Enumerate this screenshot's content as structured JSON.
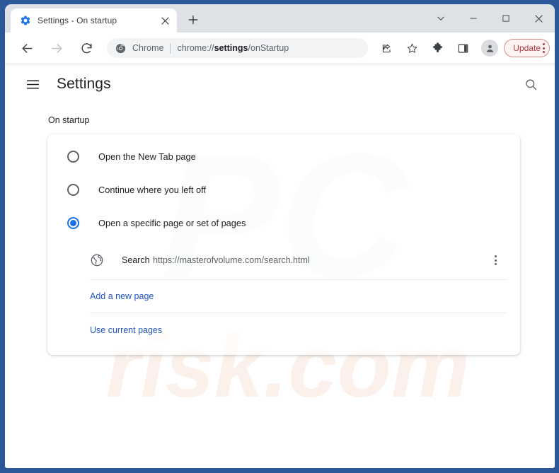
{
  "window": {
    "frame_color": "#2c5899",
    "controls": [
      {
        "name": "tab-search",
        "icon": "chevron-down-icon"
      },
      {
        "name": "minimize",
        "icon": "minimize-icon"
      },
      {
        "name": "maximize",
        "icon": "maximize-icon"
      },
      {
        "name": "close",
        "icon": "close-icon"
      }
    ]
  },
  "tabstrip": {
    "tabs": [
      {
        "title": "Settings - On startup",
        "favicon": "gear-icon",
        "active": true
      }
    ],
    "new_tab_label": "+"
  },
  "toolbar": {
    "back_icon": "back-arrow-icon",
    "forward_icon": "forward-arrow-icon",
    "reload_icon": "reload-icon",
    "omnibox": {
      "chrome_label": "Chrome",
      "url_prefix": "chrome://",
      "url_bold": "settings",
      "url_suffix": "/onStartup",
      "full_url": "chrome://settings/onStartup",
      "icon": "chrome-logo-icon"
    },
    "actions": [
      {
        "name": "share-icon"
      },
      {
        "name": "bookmark-star-icon"
      },
      {
        "name": "extensions-puzzle-icon"
      },
      {
        "name": "side-panel-icon"
      },
      {
        "name": "profile-avatar-icon"
      }
    ],
    "update_button": {
      "label": "Update",
      "text_color": "#b3383d",
      "border_color": "#d08e8e",
      "background_color": "#fdf3f3"
    }
  },
  "settings": {
    "menu_icon": "hamburger-menu-icon",
    "title": "Settings",
    "search_icon": "search-icon",
    "section_label": "On startup",
    "accent_color": "#1a73e8",
    "link_color": "#2255c4",
    "radio_options": [
      {
        "label": "Open the New Tab page",
        "selected": false
      },
      {
        "label": "Continue where you left off",
        "selected": false
      },
      {
        "label": "Open a specific page or set of pages",
        "selected": true
      }
    ],
    "startup_pages": [
      {
        "title": "Search",
        "url": "https://masterofvolume.com/search.html",
        "icon": "globe-icon",
        "menu_icon": "more-vertical-icon"
      }
    ],
    "links": [
      {
        "label": "Add a new page"
      },
      {
        "label": "Use current pages"
      }
    ]
  },
  "watermark": {
    "text_top": "PC",
    "text_bottom": "risk.com",
    "full_text": "PCrisk.com"
  }
}
